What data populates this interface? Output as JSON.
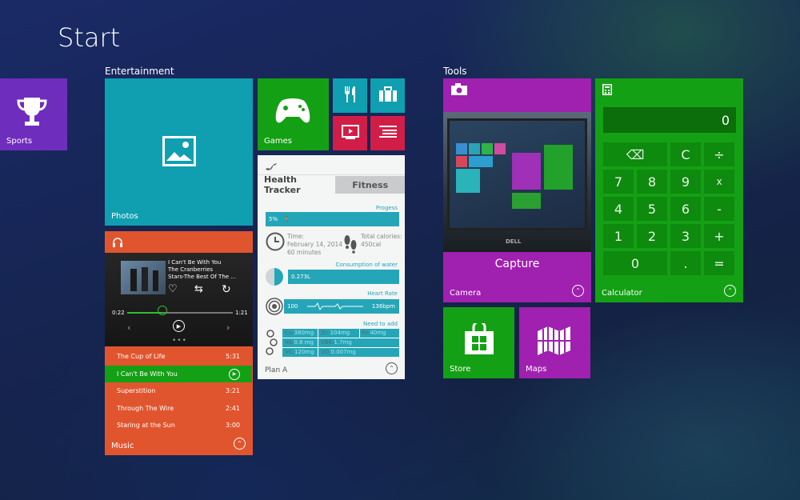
{
  "title": "Start",
  "groups": {
    "entertainment": "Entertainment",
    "tools": "Tools"
  },
  "tiles": {
    "sports": "Sports",
    "photos": "Photos",
    "games": "Games",
    "camera": "Camera",
    "calculator": "Calculator",
    "store": "Store",
    "maps": "Maps",
    "music": "Music"
  },
  "health": {
    "tab_tracker": "Health Tracker",
    "tab_fitness": "Fitness",
    "progress_label": "Progess",
    "progress_value": "5%",
    "time_label": "Time:",
    "time_date": "February 14, 2014",
    "time_duration": "60 minutes",
    "calories_label": "Total calories:",
    "calories_value": "450cal",
    "water_label": "Consumption of water",
    "water_value": "0.273L",
    "heart_label": "Heart Rate",
    "heart_start": "100",
    "heart_end": "136bpm",
    "need_label": "Need to add",
    "nutrients": [
      [
        "Ca:",
        "380mg",
        "Zn:",
        "104mg",
        "Fe:",
        "40mg"
      ],
      [
        "VA:",
        "0.8 mg",
        "VB6:",
        "1.7mg",
        "",
        ""
      ],
      [
        "VC:",
        "120mg",
        "VD:",
        "0.007mg",
        "",
        ""
      ]
    ],
    "plan": "Plan A"
  },
  "music": {
    "now_title": "I Can't Be With You",
    "now_artist": "The Cranberries",
    "now_album": "Stars-The Best Of The ...",
    "elapsed": "0:22",
    "total": "1:21",
    "progress": 0.33,
    "songs": [
      {
        "title": "The Cup of Life",
        "time": "5:31"
      },
      {
        "title": "I Can't Be With You",
        "time": ""
      },
      {
        "title": "Superstition",
        "time": "3:21"
      },
      {
        "title": "Through The Wire",
        "time": "2:41"
      },
      {
        "title": "Staring at the Sun",
        "time": "3:00"
      }
    ]
  },
  "camera": {
    "capture": "Capture",
    "brand": "DELL"
  },
  "calculator": {
    "display": "0",
    "keys": [
      "⌫",
      "C",
      "÷",
      "7",
      "8",
      "9",
      "x",
      "4",
      "5",
      "6",
      "-",
      "1",
      "2",
      "3",
      "+",
      "0",
      ".",
      "="
    ]
  },
  "colors": {
    "purple": "#6f2dbd",
    "teal": "#0f9fb0",
    "green": "#14a014",
    "magenta": "#a020b0",
    "orange": "#e1552e",
    "crimson": "#d11e48",
    "health_teal": "#25a6b8"
  }
}
